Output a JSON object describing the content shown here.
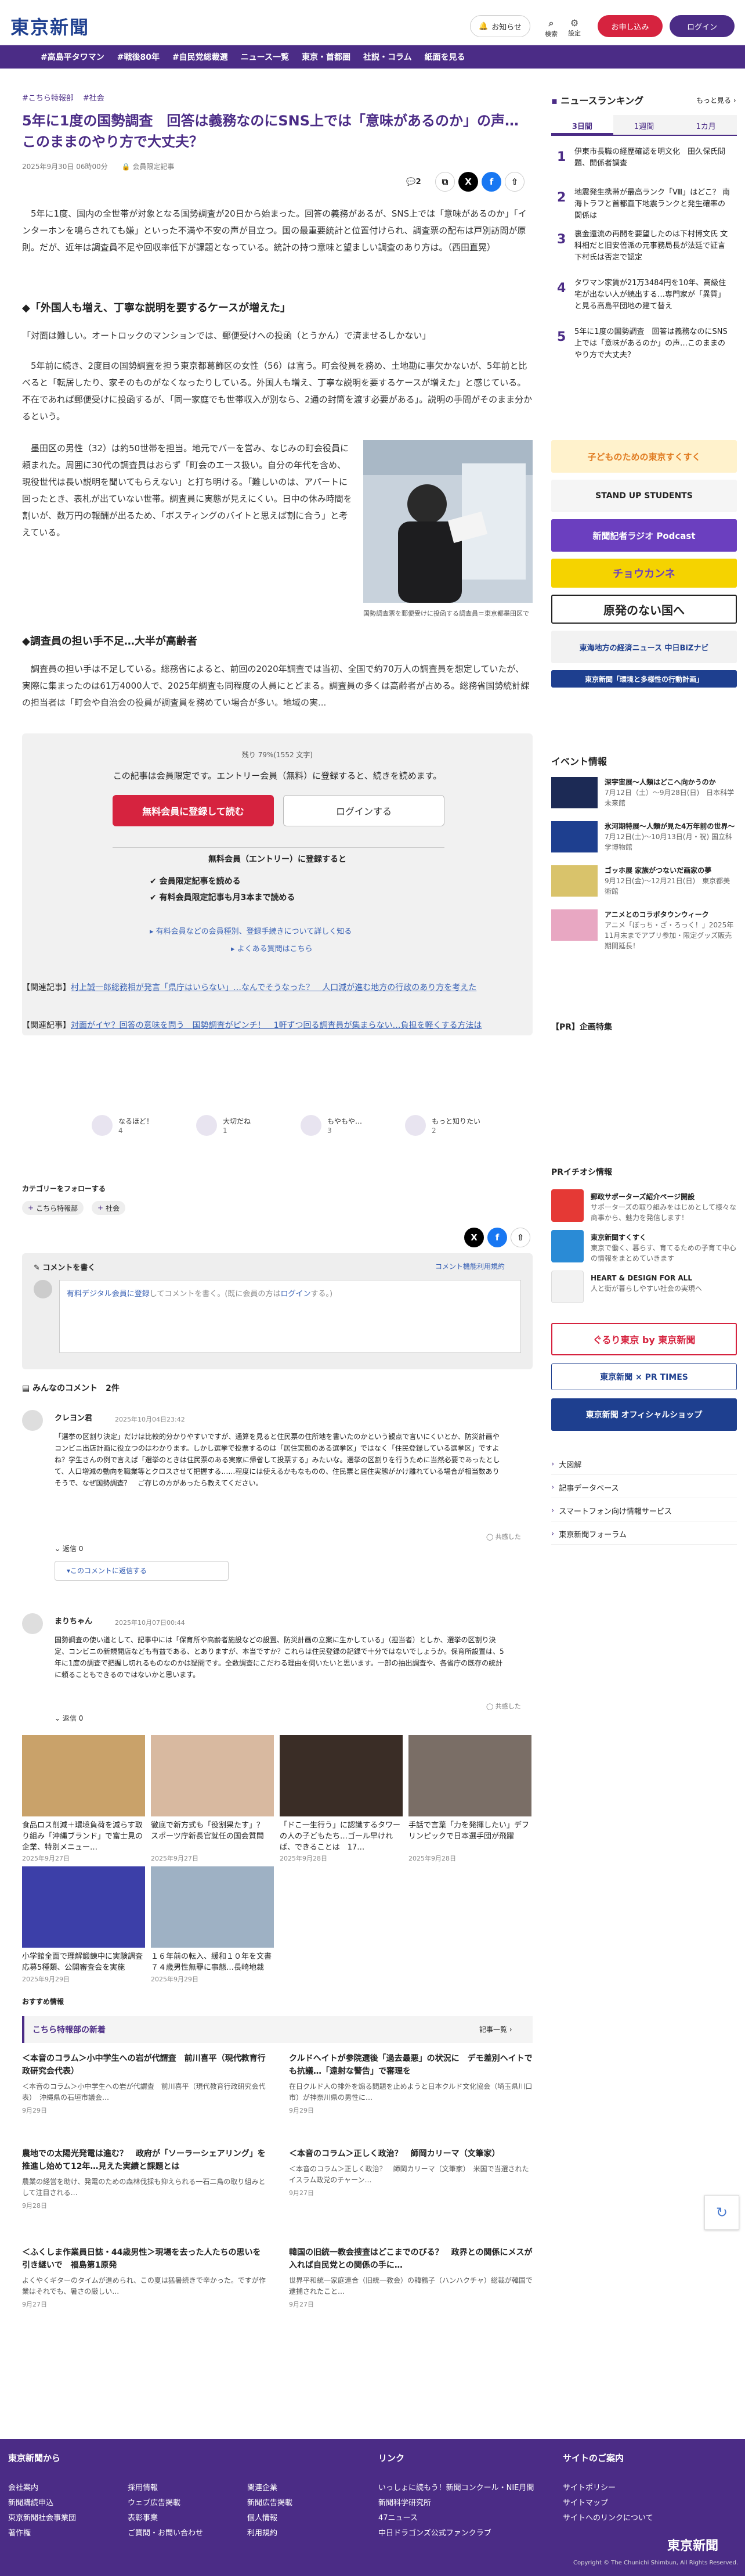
{
  "header": {
    "logo": "東京新聞",
    "notice": "お知らせ",
    "search": "検索",
    "settings": "設定",
    "register": "お申し込み",
    "login": "ログイン"
  },
  "nav": [
    "#高島平タワマン",
    "#戦後80年",
    "#自民党総裁選",
    "ニュース一覧",
    "東京・首都圏",
    "社説・コラム",
    "紙面を見る"
  ],
  "article": {
    "tags": [
      "#こちら特報部",
      "#社会"
    ],
    "title": "5年に1度の国勢調査　回答は義務なのにSNS上では「意味があるのか」の声… このままのやり方で大丈夫？",
    "date": "2025年9月30日 06時00分",
    "members": "会員限定記事",
    "comment_count": "2",
    "p1": "　5年に1度、国内の全世帯が対象となる国勢調査が20日から始まった。回答の義務があるが、SNS上では「意味があるのか」「インターホンを鳴らされても嫌」といった不満や不安の声が目立つ。国の最重要統計と位置付けられ、調査票の配布は戸別訪問が原則。だが、近年は調査員不足や回収率低下が課題となっている。統計の持つ意味と望ましい調査のあり方は。（西田直晃）",
    "h1": "◆「外国人も増え、丁寧な説明を要するケースが増えた」",
    "p2": "「対面は難しい。オートロックのマンションでは、郵便受けへの投函（とうかん）で済ませるしかない」",
    "p3": "　5年前に続き、2度目の国勢調査を担う東京都葛飾区の女性（56）は言う。町会役員を務め、土地勘に事欠かないが、5年前と比べると「転居したり、家そのものがなくなったりしている。外国人も増え、丁寧な説明を要するケースが増えた」と感じている。不在であれば郵便受けに投函するが、「同一家庭でも世帯収入が別なら、2通の封筒を渡す必要がある」。説明の手間がそのまま分かるという。",
    "p4": "　墨田区の男性（32）は約50世帯を担当。地元でバーを営み、なじみの町会役員に頼まれた。周囲に30代の調査員はおらず「町会のエース扱い。自分の年代を含め、現役世代は長い説明を聞いてもらえない」と打ち明ける。「難しいのは、アパートに回ったとき、表札が出ていない世帯。調査員に実態が見えにくい。日中の休み時間を割いが、数万円の報酬が出るため、「ボスティングのバイトと思えば割に合う」と考えている。",
    "fig_caption": "国勢調査票を郵便受けに投函する調査員＝東京都墨田区で",
    "h2": "◆調査員の担い手不足…大半が高齢者",
    "p5": "　調査員の担い手は不足している。総務省によると、前回の2020年調査では当初、全国で約70万人の調査員を想定していたが、実際に集まったのは61万4000人で、2025年調査も同程度の人員にとどまる。調査員の多くは高齢者が占める。総務省国勢統計課の担当者は「町会や自治会の役員が調査員を務めてい場合が多い。地域の実..."
  },
  "paywall": {
    "remaining": "残り 79%(1552 文字)",
    "message": "この記事は会員限定です。エントリー会員（無料）に登録すると、続きを読めます。",
    "register_btn": "無料会員に登録して読む",
    "login_btn": "ログインする",
    "entry_head": "無料会員（エントリー）に登録すると",
    "benefits": [
      "会員限定記事を読める",
      "有料会員限定記事も月3本まで読める"
    ],
    "link1": "有料会員などの会員種別、登録手続きについて詳しく知る",
    "link2": "よくある質問はこちら"
  },
  "related": [
    {
      "label": "【関連記事】",
      "text": "村上誠一郎総務相が発言「県庁はいらない」…なんでそうなった？　人口減が進む地方の行政のあり方を考えた"
    },
    {
      "label": "【関連記事】",
      "text": "対面がイヤ？回答の意味を問う　国勢調査がピンチ！　1軒ずつ回る調査員が集まらない…負担を軽くする方法は"
    }
  ],
  "reactions": [
    {
      "label": "なるほど！",
      "count": "4"
    },
    {
      "label": "大切だね",
      "count": "1"
    },
    {
      "label": "もやもや…",
      "count": "3"
    },
    {
      "label": "もっと知りたい",
      "count": "2"
    }
  ],
  "follow": {
    "head": "カテゴリーをフォローする",
    "chips": [
      "こちら特報部",
      "社会"
    ]
  },
  "comment_box": {
    "title": "コメントを書く",
    "rule": "コメント機能利用規約",
    "placeholder_lead": "有料デジタル会員に登録",
    "placeholder_rest": "してコメントを書く。(既に会員の方は",
    "placeholder_login": "ログイン",
    "placeholder_end": "する。)"
  },
  "comments_head": "みんなのコメント　2件",
  "comments": [
    {
      "user": "クレヨン君",
      "date": "2025年10月04日23:42",
      "body": "「選挙の区割り決定」だけは比較的分かりやすいですが、通算を見ると住民票の住所地を書いたのかという観点で言いにくいとか、防災計画やコンビニ出店計画に役立つのはわかります。しかし選挙で投票するのは「居住実態のある選挙区」ではなく「住民登録している選挙区」ですよね？学生さんの例で言えば「選挙のときは住民票のある実家に帰省して投票する」みたいな。選挙の区割りを行うために当然必要であったとして、人口増減の動向を職業等とクロスさせて把握する……程度には使えるかもなものの、住民票と居住実態がかけ離れている場合が相当数ありそうで、なぜ国勢調査？　ご存じの方があったら教えてください。",
      "likes": "0",
      "reply": "このコメントに返信する"
    },
    {
      "user": "まりちゃん",
      "date": "2025年10月07日00:44",
      "body": "国勢調査の使い道として、記事中には「保育所や高齢者施設などの設置、防災計画の立案に生かしている」（担当者）としか、選挙の区割り決定、コンビニの新規開店なども有益である、とありますが、本当ですか？これらは住民登録の記録で十分ではないでしょうか。保育所設置は、5年に1度の調査で把握し切れるものなのかは疑問です。全数調査にこだわる理由を伺いたいと思います。一部の抽出調査や、各省庁の既存の統計に頼ることもできるのではないかと思います。",
      "likes": "0"
    }
  ],
  "cards": [
    {
      "title": "食品ロス削減＋環境負荷を減らす取り組み「沖縄ブランド」で富士見の企業、特別メニュー…",
      "date": "2025年9月27日"
    },
    {
      "title": "徹底で新方式も「役割果たす」？ スポーツ庁新長官就任の国会質問",
      "date": "2025年9月27日"
    },
    {
      "title": "「ドこ一生行う」に認識するタワーの人の子どもたち…ゴール早ければ、できることは　17…",
      "date": "2025年9月28日"
    },
    {
      "title": "手話で言葉「力を発揮したい」デフリンピックで日本選手団が飛躍",
      "date": "2025年9月28日"
    },
    {
      "title": "小学館全面で理解鍛錬中に実験調査応募5種類、公開審査会を実施",
      "date": "2025年9月29日"
    },
    {
      "title": "１６年前の転入、緩和１０年を文書　７４歳男性無罪に事態…長崎地裁",
      "date": "2025年9月29日"
    }
  ],
  "recommend_head": "おすすめ情報",
  "tokuho": {
    "head": "こちら特報部の新着",
    "more": "記事一覧",
    "items": [
      {
        "title": "＜本音のコラム＞小中学生への岩が代謂査　前川喜平（現代教育行政研究会代表）",
        "desc": "＜本音のコラム＞小中学生への岩が代謂査　前川喜平（現代教育行政研究会代表）　沖縄県の石垣市議会…",
        "date": "9月29日"
      },
      {
        "title": "クルドヘイトが参院選後「過去最悪」の状況に　デモ差別ヘイトでも抗議…「遠射な警告」で審理を",
        "desc": "在日クルド人の排外を煽る問題を止めようと日本クルド文化協会（埼玉県川口市）が神奈川県の男性に…",
        "date": "9月29日"
      },
      {
        "title": "農地での太陽光発電は進む？　政府が「ソーラーシェアリング」を推進し始めて12年…見えた実績と課題とは",
        "desc": "農業の経営を助け、発電のための森林伐採も抑えられる一石二鳥の取り組みとして注目される…",
        "date": "9月28日"
      },
      {
        "title": "＜本音のコラム＞正しく政治？　師岡カリーマ（文筆家）",
        "desc": "＜本音のコラム＞正しく政治？　師岡カリーマ（文筆家）　米国で当選されたイスラム政党のチャーン…",
        "date": "9月27日"
      },
      {
        "title": "＜ふくしま作業員日誌・44歳男性＞現場を去った人たちの思いを引き継いで　福島第1原発",
        "desc": "よくやくギターのタイムが進められ、この夏は猛暑続きで辛かった。ですが作業はそれでも、暑さの厳しい…",
        "date": "9月27日"
      },
      {
        "title": "韓国の旧統一教会捜査はどこまでのびる？　政界との関係にメスが入れば自民党との関係の手に…",
        "desc": "世界平和統一家庭連合（旧統一教会）の韓鶴子（ハンハクチャ）総裁が韓国で逮捕されたこと…",
        "date": "9月27日"
      }
    ]
  },
  "ranking": {
    "head": "ニュースランキング",
    "more": "もっと見る",
    "tabs": [
      "3日間",
      "1週間",
      "1カ月"
    ],
    "items": [
      {
        "num": "1",
        "text": "伊東市長職の経歴確認を明文化　田久保氏問題、開係者調査"
      },
      {
        "num": "2",
        "text": "地震発生携帯が最高ランク「Ⅷ」はどこ？ 南海トラフと首都直下地震ランクと発生確率の関係は"
      },
      {
        "num": "3",
        "text": "裏金還流の再開を要望したのは下村博文氏 文科相だと旧安倍派の元事務局長が法廷で証言　下村氏は否定で認定"
      },
      {
        "num": "4",
        "text": "タワマン家賃が21万3484円を10年、高級住宅が出ない人が続出する…専門家が「異質」と見る高島平団地の建て替え"
      },
      {
        "num": "5",
        "text": "5年に1度の国勢調査　回答は義務なのにSNS上では「意味があるのか」の声…このままのやり方で大丈夫？"
      }
    ]
  },
  "ads": [
    "子どものための東京すくすく",
    "STAND UP STUDENTS",
    "新聞記者ラジオ Podcast",
    "チョウカンネ",
    "原発のない国へ",
    "東海地方の経済ニュース 中日BiZナビ",
    "東京新聞「環境と多様性の行動計画」"
  ],
  "events": {
    "head": "イベント情報",
    "items": [
      {
        "title": "深宇宙展〜人類はどこへ向かうのか",
        "desc": "7月12日（土）〜9月28日(日)　日本科学未来館"
      },
      {
        "title": "氷河期特展～人類が見た4万年前の世界～",
        "desc": "7月12日(土)〜10月13日(月・祝) 国立科学博物館"
      },
      {
        "title": "ゴッホ展 家族がつないだ画家の夢",
        "desc": "9月12日(金)〜12月21日(日)　東京都美術館"
      },
      {
        "title": "アニメとのコラボタウンウィーク",
        "desc": "アニメ「ぼっち・ざ・ろっく！」2025年11月末までアプリ参加・限定グッズ販売期間延長！"
      }
    ]
  },
  "pr_plan": "【PR】企画特集",
  "pr": {
    "head": "PRイチオシ情報",
    "items": [
      {
        "title": "郵政サポーターズ紹介ページ開設",
        "desc": "サポーターズの取り組みをはじめとして様々な商事から、魅力を発信します！"
      },
      {
        "title": "東京新聞すくすく",
        "desc": "東京で働く、暮らす、育てるための子育て中心の情報をまとめていきます"
      },
      {
        "title": "HEART & DESIGN FOR ALL",
        "desc": "人と街が暮らしやすい社会の実現へ"
      }
    ]
  },
  "side_ads2": [
    "ぐるり東京 by 東京新聞",
    "東京新聞 × PR TIMES",
    "東京新聞 オフィシャルショップ"
  ],
  "side_links": [
    "大図解",
    "記事データベース",
    "スマートフォン向け情報サービス",
    "東京新聞フォーラム"
  ],
  "footer": {
    "col1_head": "東京新聞から",
    "col1": [
      "会社案内",
      "新聞購読申込",
      "東京新聞社会事業団",
      "著作権"
    ],
    "col2": [
      "採用情報",
      "ウェブ広告掲載",
      "表彰事業",
      "ご質問・お問い合わせ"
    ],
    "col3": [
      "関連企業",
      "新聞広告掲載",
      "個人情報",
      "利用規約"
    ],
    "col4_head": "リンク",
    "col4": [
      "いっしょに読もう！新聞コンクール・NIE月間",
      "新聞科学研究所",
      "47ニュース",
      "中日ドラゴンズ公式ファンクラブ"
    ],
    "col5_head": "サイトのご案内",
    "col5": [
      "サイトポリシー",
      "サイトマップ",
      "サイトへのリンクについて"
    ],
    "logo": "東京新聞",
    "copyright": "Copyright © The Chunichi Shimbun, All Rights Reserved."
  },
  "colors": {
    "brand": "#4b2c86",
    "accent": "#d6233f",
    "link": "#3a62b5"
  }
}
